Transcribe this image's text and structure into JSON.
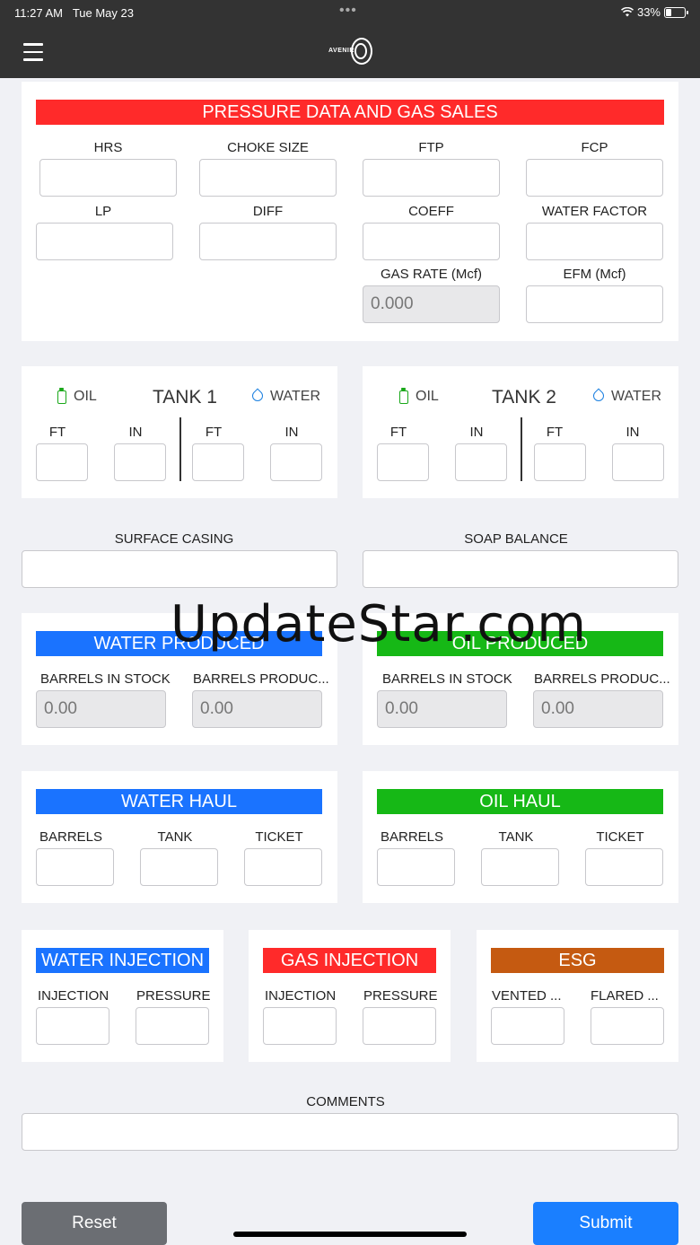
{
  "status": {
    "time": "11:27 AM",
    "date": "Tue May 23",
    "battery": "33%",
    "battery_level": 0.33
  },
  "nav": {
    "logo_text": "AVENIR"
  },
  "pressure": {
    "title": "PRESSURE DATA AND GAS SALES",
    "labels": [
      "HRS",
      "CHOKE SIZE",
      "FTP",
      "FCP",
      "LP",
      "DIFF",
      "COEFF",
      "WATER FACTOR",
      "GAS RATE (Mcf)",
      "EFM (Mcf)"
    ],
    "gas_rate_value": "0.000"
  },
  "tank1": {
    "title": "TANK 1",
    "oil": "OIL",
    "water": "WATER",
    "ft": "FT",
    "in": "IN"
  },
  "tank2": {
    "title": "TANK 2",
    "oil": "OIL",
    "water": "WATER",
    "ft": "FT",
    "in": "IN"
  },
  "surface_casing": "SURFACE CASING",
  "soap_balance": "SOAP BALANCE",
  "water_produced": {
    "title": "WATER PRODUCED",
    "stock_label": "BARRELS IN STOCK",
    "produced_label": "BARRELS PRODUC...",
    "stock_value": "0.00",
    "produced_value": "0.00"
  },
  "oil_produced": {
    "title": "OIL PRODUCED",
    "stock_label": "BARRELS IN STOCK",
    "produced_label": "BARRELS PRODUC...",
    "stock_value": "0.00",
    "produced_value": "0.00"
  },
  "water_haul": {
    "title": "WATER HAUL",
    "barrels": "BARRELS",
    "tank": "TANK",
    "ticket": "TICKET"
  },
  "oil_haul": {
    "title": "OIL HAUL",
    "barrels": "BARRELS",
    "tank": "TANK",
    "ticket": "TICKET"
  },
  "water_injection": {
    "title": "WATER INJECTION",
    "injection": "INJECTION",
    "pressure": "PRESSURE"
  },
  "gas_injection": {
    "title": "GAS INJECTION",
    "injection": "INJECTION",
    "pressure": "PRESSURE"
  },
  "esg": {
    "title": "ESG",
    "vented": "VENTED ...",
    "flared": "FLARED ..."
  },
  "comments": "COMMENTS",
  "buttons": {
    "reset": "Reset",
    "submit": "Submit"
  },
  "watermark": "UpdateStar.com",
  "colors": {
    "red": "#ff2a2a",
    "blue": "#1a73ff",
    "green": "#16b816",
    "orange": "#c55a11",
    "reset_bg": "#6b6e73",
    "submit_bg": "#1a7fff"
  }
}
